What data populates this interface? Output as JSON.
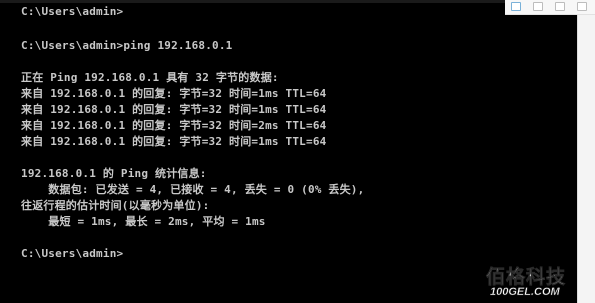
{
  "console": {
    "lines": [
      "C:\\Users\\admin>",
      "C:\\Users\\admin>ping 192.168.0.1",
      "正在 Ping 192.168.0.1 具有 32 字节的数据:",
      "来自 192.168.0.1 的回复: 字节=32 时间=1ms TTL=64",
      "来自 192.168.0.1 的回复: 字节=32 时间=1ms TTL=64",
      "来自 192.168.0.1 的回复: 字节=32 时间=2ms TTL=64",
      "来自 192.168.0.1 的回复: 字节=32 时间=1ms TTL=64",
      "192.168.0.1 的 Ping 统计信息:",
      "    数据包: 已发送 = 4, 已接收 = 4, 丢失 = 0 (0% 丢失),",
      "往返行程的估计时间(以毫秒为单位):",
      "    最短 = 1ms, 最长 = 2ms, 平均 = 1ms",
      "C:\\Users\\admin>"
    ]
  },
  "watermark": {
    "title": "佰格科技",
    "url": "100GEL.COM"
  },
  "colors": {
    "console_bg": "#000000",
    "console_text": "#c8c8c8"
  }
}
